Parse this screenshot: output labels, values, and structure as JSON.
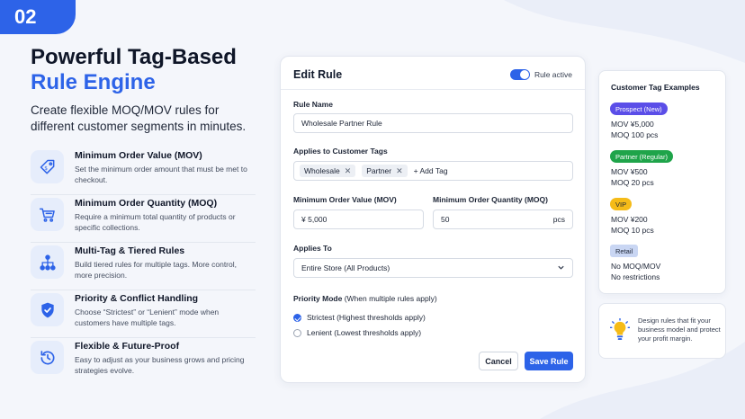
{
  "badge": "02",
  "headline": {
    "line1": "Powerful Tag-Based",
    "line2": "Rule Engine"
  },
  "subhead": "Create flexible MOQ/MOV rules for different customer segments in minutes.",
  "features": [
    {
      "icon": "price-tag-icon",
      "title": "Minimum Order Value (MOV)",
      "desc": "Set the minimum order amount that must be met to checkout."
    },
    {
      "icon": "cart-icon",
      "title": "Minimum Order Quantity (MOQ)",
      "desc": "Require a minimum total quantity of products or specific collections."
    },
    {
      "icon": "hierarchy-icon",
      "title": "Multi-Tag & Tiered Rules",
      "desc": "Build tiered rules for multiple tags. More control, more precision."
    },
    {
      "icon": "shield-check-icon",
      "title": "Priority & Conflict Handling",
      "desc": "Choose “Strictest” or “Lenient” mode when customers have multiple tags."
    },
    {
      "icon": "history-icon",
      "title": "Flexible & Future-Proof",
      "desc": "Easy to adjust as your business grows and pricing strategies evolve."
    }
  ],
  "edit_rule": {
    "title": "Edit Rule",
    "active_label": "Rule active",
    "rule_name_label": "Rule Name",
    "rule_name_value": "Wholesale Partner Rule",
    "tags_label": "Applies to Customer Tags",
    "tags": [
      "Wholesale",
      "Partner"
    ],
    "add_tag": "+ Add Tag",
    "mov_label": "Minimum Order Value (MOV)",
    "mov_value": "¥ 5,000",
    "moq_label": "Minimum Order Quantity (MOQ)",
    "moq_value": "50",
    "moq_unit": "pcs",
    "applies_to_label": "Applies To",
    "applies_to_value": "Entire Store (All Products)",
    "priority_label": "Priority Mode",
    "priority_hint": "(When multiple rules apply)",
    "options": [
      {
        "label": "Strictest",
        "hint": "(Highest thresholds apply)",
        "checked": true
      },
      {
        "label": "Lenient",
        "hint": "(Lowest thresholds apply)",
        "checked": false
      }
    ],
    "cancel": "Cancel",
    "save": "Save Rule"
  },
  "examples": {
    "title": "Customer Tag Examples",
    "items": [
      {
        "tag": "Prospect (New)",
        "color": "#5b4ee8",
        "line1": "MOV  ¥5,000",
        "line2": "MOQ  100 pcs"
      },
      {
        "tag": "Partner (Regular)",
        "color": "#1fa44a",
        "line1": "MOV  ¥500",
        "line2": "MOQ  20 pcs"
      },
      {
        "tag": "VIP",
        "color": "#f5bb18",
        "line1": "MOV  ¥200",
        "line2": "MOQ  10 pcs"
      },
      {
        "tag": "Retail",
        "color": "#c9d6f3",
        "line1": "No MOQ/MOV",
        "line2": "No restrictions"
      }
    ]
  },
  "tip": "Design rules that fit your business model and protect your profit margin.",
  "colors": {
    "accent": "#2d63e8"
  }
}
